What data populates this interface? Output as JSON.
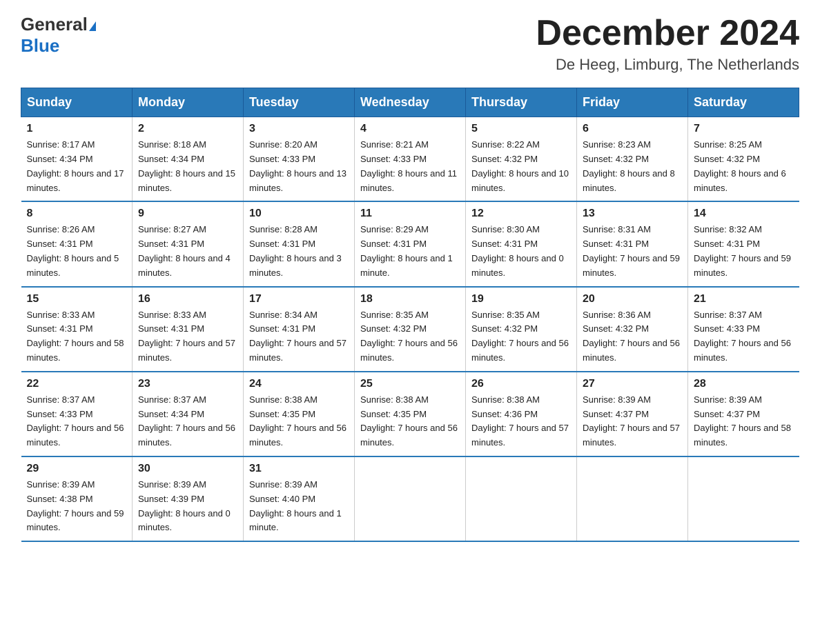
{
  "header": {
    "logo_line1": "General",
    "logo_line2": "Blue",
    "month_title": "December 2024",
    "location": "De Heeg, Limburg, The Netherlands"
  },
  "weekdays": [
    "Sunday",
    "Monday",
    "Tuesday",
    "Wednesday",
    "Thursday",
    "Friday",
    "Saturday"
  ],
  "weeks": [
    [
      {
        "day": "1",
        "sunrise": "8:17 AM",
        "sunset": "4:34 PM",
        "daylight": "8 hours and 17 minutes."
      },
      {
        "day": "2",
        "sunrise": "8:18 AM",
        "sunset": "4:34 PM",
        "daylight": "8 hours and 15 minutes."
      },
      {
        "day": "3",
        "sunrise": "8:20 AM",
        "sunset": "4:33 PM",
        "daylight": "8 hours and 13 minutes."
      },
      {
        "day": "4",
        "sunrise": "8:21 AM",
        "sunset": "4:33 PM",
        "daylight": "8 hours and 11 minutes."
      },
      {
        "day": "5",
        "sunrise": "8:22 AM",
        "sunset": "4:32 PM",
        "daylight": "8 hours and 10 minutes."
      },
      {
        "day": "6",
        "sunrise": "8:23 AM",
        "sunset": "4:32 PM",
        "daylight": "8 hours and 8 minutes."
      },
      {
        "day": "7",
        "sunrise": "8:25 AM",
        "sunset": "4:32 PM",
        "daylight": "8 hours and 6 minutes."
      }
    ],
    [
      {
        "day": "8",
        "sunrise": "8:26 AM",
        "sunset": "4:31 PM",
        "daylight": "8 hours and 5 minutes."
      },
      {
        "day": "9",
        "sunrise": "8:27 AM",
        "sunset": "4:31 PM",
        "daylight": "8 hours and 4 minutes."
      },
      {
        "day": "10",
        "sunrise": "8:28 AM",
        "sunset": "4:31 PM",
        "daylight": "8 hours and 3 minutes."
      },
      {
        "day": "11",
        "sunrise": "8:29 AM",
        "sunset": "4:31 PM",
        "daylight": "8 hours and 1 minute."
      },
      {
        "day": "12",
        "sunrise": "8:30 AM",
        "sunset": "4:31 PM",
        "daylight": "8 hours and 0 minutes."
      },
      {
        "day": "13",
        "sunrise": "8:31 AM",
        "sunset": "4:31 PM",
        "daylight": "7 hours and 59 minutes."
      },
      {
        "day": "14",
        "sunrise": "8:32 AM",
        "sunset": "4:31 PM",
        "daylight": "7 hours and 59 minutes."
      }
    ],
    [
      {
        "day": "15",
        "sunrise": "8:33 AM",
        "sunset": "4:31 PM",
        "daylight": "7 hours and 58 minutes."
      },
      {
        "day": "16",
        "sunrise": "8:33 AM",
        "sunset": "4:31 PM",
        "daylight": "7 hours and 57 minutes."
      },
      {
        "day": "17",
        "sunrise": "8:34 AM",
        "sunset": "4:31 PM",
        "daylight": "7 hours and 57 minutes."
      },
      {
        "day": "18",
        "sunrise": "8:35 AM",
        "sunset": "4:32 PM",
        "daylight": "7 hours and 56 minutes."
      },
      {
        "day": "19",
        "sunrise": "8:35 AM",
        "sunset": "4:32 PM",
        "daylight": "7 hours and 56 minutes."
      },
      {
        "day": "20",
        "sunrise": "8:36 AM",
        "sunset": "4:32 PM",
        "daylight": "7 hours and 56 minutes."
      },
      {
        "day": "21",
        "sunrise": "8:37 AM",
        "sunset": "4:33 PM",
        "daylight": "7 hours and 56 minutes."
      }
    ],
    [
      {
        "day": "22",
        "sunrise": "8:37 AM",
        "sunset": "4:33 PM",
        "daylight": "7 hours and 56 minutes."
      },
      {
        "day": "23",
        "sunrise": "8:37 AM",
        "sunset": "4:34 PM",
        "daylight": "7 hours and 56 minutes."
      },
      {
        "day": "24",
        "sunrise": "8:38 AM",
        "sunset": "4:35 PM",
        "daylight": "7 hours and 56 minutes."
      },
      {
        "day": "25",
        "sunrise": "8:38 AM",
        "sunset": "4:35 PM",
        "daylight": "7 hours and 56 minutes."
      },
      {
        "day": "26",
        "sunrise": "8:38 AM",
        "sunset": "4:36 PM",
        "daylight": "7 hours and 57 minutes."
      },
      {
        "day": "27",
        "sunrise": "8:39 AM",
        "sunset": "4:37 PM",
        "daylight": "7 hours and 57 minutes."
      },
      {
        "day": "28",
        "sunrise": "8:39 AM",
        "sunset": "4:37 PM",
        "daylight": "7 hours and 58 minutes."
      }
    ],
    [
      {
        "day": "29",
        "sunrise": "8:39 AM",
        "sunset": "4:38 PM",
        "daylight": "7 hours and 59 minutes."
      },
      {
        "day": "30",
        "sunrise": "8:39 AM",
        "sunset": "4:39 PM",
        "daylight": "8 hours and 0 minutes."
      },
      {
        "day": "31",
        "sunrise": "8:39 AM",
        "sunset": "4:40 PM",
        "daylight": "8 hours and 1 minute."
      },
      null,
      null,
      null,
      null
    ]
  ],
  "labels": {
    "sunrise_prefix": "Sunrise: ",
    "sunset_prefix": "Sunset: ",
    "daylight_prefix": "Daylight: "
  }
}
